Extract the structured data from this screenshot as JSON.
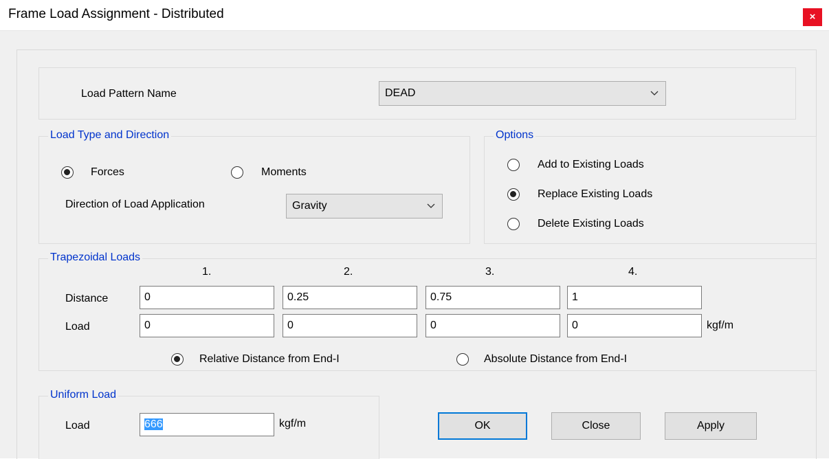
{
  "window": {
    "title": "Frame Load Assignment - Distributed",
    "close_glyph": "×"
  },
  "load_pattern": {
    "label": "Load Pattern Name",
    "value": "DEAD"
  },
  "load_type": {
    "legend": "Load Type and Direction",
    "forces_label": "Forces",
    "moments_label": "Moments",
    "selected": "Forces",
    "direction_label": "Direction of Load Application",
    "direction_value": "Gravity"
  },
  "options": {
    "legend": "Options",
    "items": [
      "Add to Existing Loads",
      "Replace Existing Loads",
      "Delete Existing Loads"
    ],
    "selected": "Replace Existing Loads"
  },
  "trapezoidal": {
    "legend": "Trapezoidal Loads",
    "columns": [
      "1.",
      "2.",
      "3.",
      "4."
    ],
    "distance_label": "Distance",
    "load_label": "Load",
    "distances": [
      "0",
      "0.25",
      "0.75",
      "1"
    ],
    "loads": [
      "0",
      "0",
      "0",
      "0"
    ],
    "unit": "kgf/m",
    "relative_label": "Relative Distance from End-I",
    "absolute_label": "Absolute Distance from End-I",
    "selected": "Relative Distance from End-I"
  },
  "uniform": {
    "legend": "Uniform Load",
    "load_label": "Load",
    "value": "666",
    "unit": "kgf/m"
  },
  "buttons": {
    "ok": "OK",
    "close": "Close",
    "apply": "Apply"
  }
}
